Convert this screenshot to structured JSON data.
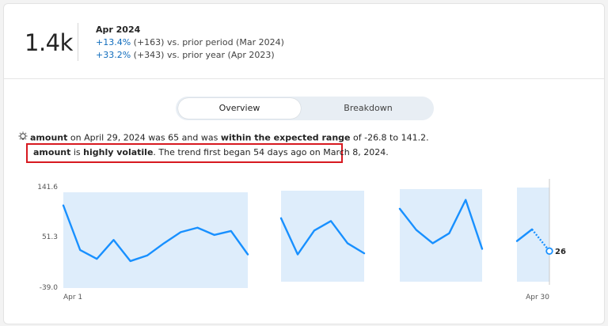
{
  "kpi": {
    "value": "1.4k",
    "period": "Apr 2024",
    "comparisons": [
      {
        "pct": "+13.4%",
        "rest": " (+163) vs. prior period (Mar 2024)"
      },
      {
        "pct": "+33.2%",
        "rest": " (+343) vs. prior year (Apr 2023)"
      }
    ]
  },
  "tabs": {
    "overview": "Overview",
    "breakdown": "Breakdown",
    "selected": "Overview"
  },
  "insight": {
    "line1_parts": [
      "amount",
      " on April 29, 2024 was 65 and was ",
      "within the expected range",
      " of -26.8 to 141.2."
    ],
    "line2_parts": [
      "amount",
      " is ",
      "highly volatile",
      ". The trend first began 54 days ago on March 8, 2024."
    ],
    "icon": "lightbulb-icon"
  },
  "colors": {
    "accent": "#1890ff",
    "band": "#deedfb",
    "highlight": "#d71920",
    "link": "#0f6cbd"
  },
  "chart_data": {
    "type": "line",
    "y_ticks": [
      "141.6",
      "51.3",
      "-39.0"
    ],
    "ylim": [
      -39.0,
      141.6
    ],
    "x_ticks": [
      "Apr 1",
      "Apr 30"
    ],
    "expected_range": [
      -26.8,
      141.2
    ],
    "segments": [
      {
        "days": [
          1,
          2,
          3,
          4,
          5,
          6,
          7,
          8,
          9,
          10,
          11
        ],
        "values": [
          108,
          28,
          12,
          46,
          8,
          18,
          40,
          60,
          68,
          55,
          62,
          20
        ]
      },
      {
        "days": [
          15,
          16,
          17,
          18,
          19,
          20
        ],
        "values": [
          85,
          20,
          63,
          80,
          40,
          22
        ]
      },
      {
        "days": [
          22,
          23,
          24,
          25,
          26,
          27
        ],
        "values": [
          102,
          64,
          40,
          58,
          118,
          30
        ]
      },
      {
        "days": [
          28,
          29
        ],
        "values": [
          44,
          65
        ]
      }
    ],
    "forecast": {
      "from_day": 29,
      "from_value": 65,
      "to_day": 30,
      "to_value": 26,
      "label": "26"
    }
  }
}
